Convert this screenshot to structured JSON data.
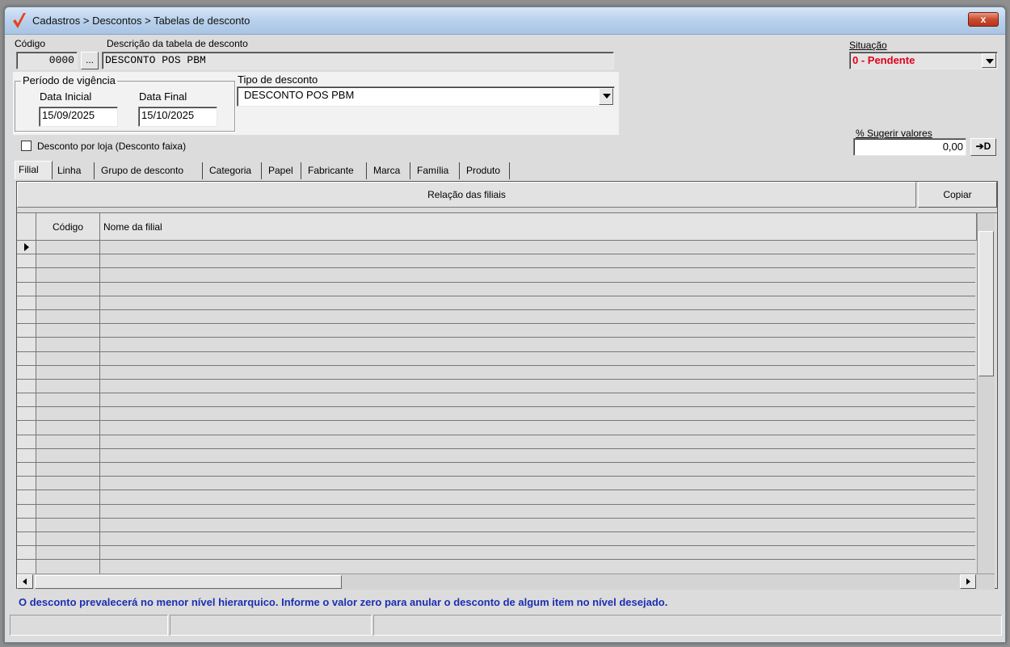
{
  "window": {
    "title": "Cadastros > Descontos > Tabelas de desconto",
    "close_label": "x"
  },
  "header": {
    "codigo_label": "Código",
    "codigo_value": "0000",
    "lookup_button_label": "...",
    "descricao_label": "Descrição da tabela de desconto",
    "descricao_value": "DESCONTO POS PBM",
    "situacao_label": "Situação",
    "situacao_value": "0 - Pendente",
    "situacao_color": "#e0001a"
  },
  "vigencia": {
    "group_label": "Período de vigência",
    "data_inicial_label": "Data Inicial",
    "data_inicial_value": "15/09/2025",
    "data_final_label": "Data Final",
    "data_final_value": "15/10/2025"
  },
  "tipo_desconto": {
    "label": "Tipo de desconto",
    "value": "DESCONTO POS PBM"
  },
  "desconto_por_loja": {
    "label": "Desconto por loja (Desconto faixa)",
    "checked": false
  },
  "sugerir": {
    "label": "% Sugerir valores",
    "value": "0,00",
    "apply_button_label": "➔D"
  },
  "tabs": [
    "Filial",
    "Linha",
    "Grupo de desconto",
    "Categoria",
    "Papel",
    "Fabricante",
    "Marca",
    "Família",
    "Produto"
  ],
  "active_tab": "Filial",
  "grid": {
    "header_title": "Relação das filiais",
    "copy_button_label": "Copiar",
    "columns": [
      "Código",
      "Nome da filial"
    ],
    "row_count": 24
  },
  "footer_note": "O desconto prevalecerá no menor nível hierarquico. Informe o valor zero para anular o desconto de algum item no nível desejado.",
  "colors": {
    "accent_blue": "#1c2fb2",
    "logo_red": "#e8411c"
  }
}
